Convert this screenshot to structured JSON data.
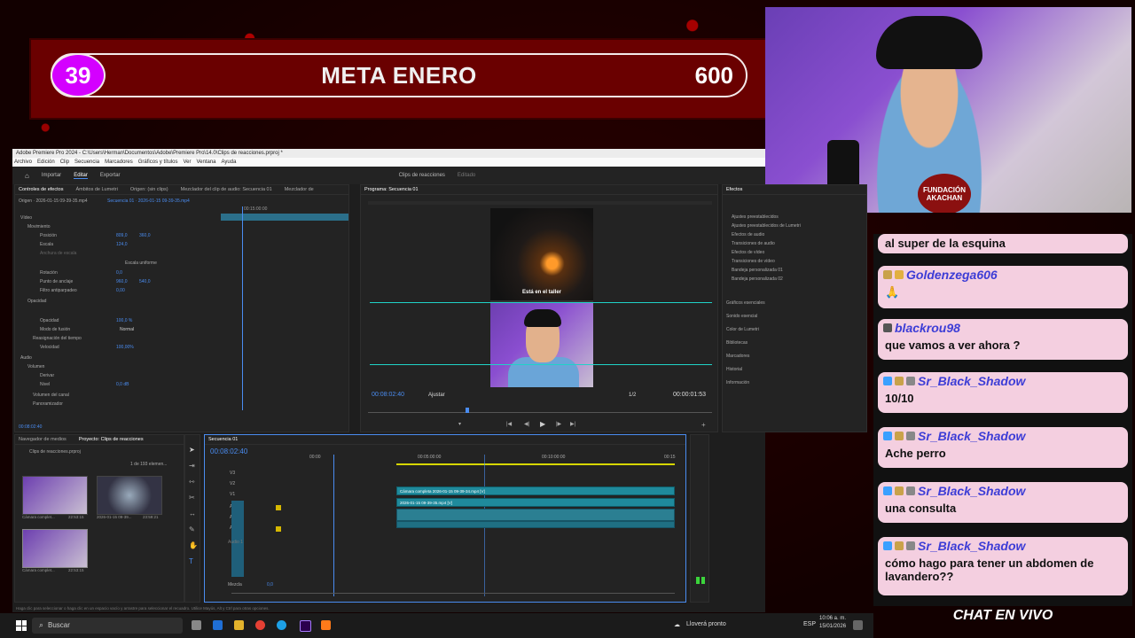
{
  "banner": {
    "count": "39",
    "title": "META ENERO",
    "goal": "600"
  },
  "webcam": {
    "logo_text": "FUNDACIÓN AKACHAN"
  },
  "chat": {
    "partial_top": "al super de la esquina",
    "messages": [
      {
        "user": "Goldenzega606",
        "text": ""
      },
      {
        "user": "blackrou98",
        "text": "que vamos a ver ahora ?"
      },
      {
        "user": "Sr_Black_Shadow",
        "text": "10/10"
      },
      {
        "user": "Sr_Black_Shadow",
        "text": "Ache perro"
      },
      {
        "user": "Sr_Black_Shadow",
        "text": "una consulta"
      },
      {
        "user": "Sr_Black_Shadow",
        "text": "cómo hago para tener un abdomen de lavandero??"
      }
    ],
    "footer": "CHAT EN VIVO"
  },
  "premiere": {
    "window_title": "Adobe Premiere Pro 2024 - C:\\Users\\Herman\\Documentos\\Adobe\\Premiere Pro\\14.0\\Clips de reacciones.prproj *",
    "menu": [
      "Archivo",
      "Edición",
      "Clip",
      "Secuencia",
      "Marcadores",
      "Gráficos y títulos",
      "Ver",
      "Ventana",
      "Ayuda"
    ],
    "workspace_tabs": [
      "Importar",
      "Editar",
      "Exportar"
    ],
    "project_title": "Clips de reacciones",
    "project_status": "Editado",
    "effect_controls": {
      "tabs": [
        "Controles de efectos",
        "Ámbitos de Lumetri",
        "Origen: (sin clips)",
        "Mezclador del clip de audio: Secuencia 01",
        "Mezclador de"
      ],
      "source": "Origen · 2026-01-15 09-39-35.mp4",
      "seq": "Secuencia 01 · 2026-01-15 09-39-35.mp4",
      "timecode": "00:15:00:00",
      "rows": [
        {
          "label": "Vídeo",
          "v1": "",
          "v2": ""
        },
        {
          "label": "Movimiento",
          "v1": "",
          "v2": ""
        },
        {
          "label": "Posición",
          "v1": "809,0",
          "v2": "360,0"
        },
        {
          "label": "Escala",
          "v1": "124,0",
          "v2": ""
        },
        {
          "label": "Anchura de escala",
          "v1": "",
          "v2": ""
        },
        {
          "label": "Escala uniforme",
          "v1": "",
          "v2": ""
        },
        {
          "label": "Rotación",
          "v1": "0,0",
          "v2": ""
        },
        {
          "label": "Punto de anclaje",
          "v1": "960,0",
          "v2": "540,0"
        },
        {
          "label": "Filtro antiparpadeo",
          "v1": "0,00",
          "v2": ""
        },
        {
          "label": "Opacidad",
          "v1": "",
          "v2": ""
        },
        {
          "label": "Opacidad",
          "v1": "100,0 %",
          "v2": ""
        },
        {
          "label": "Modo de fusión",
          "v1": "Normal",
          "v2": ""
        },
        {
          "label": "Reasignación del tiempo",
          "v1": "",
          "v2": ""
        },
        {
          "label": "Velocidad",
          "v1": "100,00%",
          "v2": ""
        },
        {
          "label": "Audio",
          "v1": "",
          "v2": ""
        },
        {
          "label": "Volumen",
          "v1": "",
          "v2": ""
        },
        {
          "label": "Derivar",
          "v1": "",
          "v2": ""
        },
        {
          "label": "Nivel",
          "v1": "0,0 dB",
          "v2": ""
        },
        {
          "label": "Volumen del canal",
          "v1": "",
          "v2": ""
        },
        {
          "label": "Panoramizador",
          "v1": "",
          "v2": ""
        }
      ],
      "bottom_timecode": "00:08:02:40"
    },
    "program": {
      "tab": "Programa: Secuencia 01",
      "caption": "Está en el taller",
      "current_tc": "00:08:02:40",
      "fit": "Ajustar",
      "ratio": "1/2",
      "duration": "00:00:01:53"
    },
    "effects": {
      "tab": "Efectos",
      "folders": [
        "Ajustes preestablecidos",
        "Ajustes preestablecidos de Lumetri",
        "Efectos de audio",
        "Transiciones de audio",
        "Efectos de vídeo",
        "Transiciones de vídeo",
        "Bandeja personalizada 01",
        "Bandeja personalizada 02"
      ],
      "sections": [
        "Gráficos esenciales",
        "Sonido esencial",
        "Color de Lumetri",
        "Bibliotecas",
        "Marcadores",
        "Historial",
        "Información"
      ]
    },
    "project": {
      "tabs": [
        "Navegador de medios",
        "Proyecto: Clips de reacciones"
      ],
      "file": "Clips de reacciones.prproj",
      "count": "1 de 193 elemen...",
      "items": [
        {
          "name": "Cámara complet...",
          "dur": "22:53:15"
        },
        {
          "name": "2026-01-15 09-39...",
          "dur": "23:59:21"
        },
        {
          "name": "Cámara complet...",
          "dur": "22:53:15"
        }
      ]
    },
    "timeline": {
      "tab": "Secuencia 01",
      "current_tc": "00:08:02:40",
      "ruler": [
        "00:00",
        "00:05:00:00",
        "00:10:00:00",
        "00:15"
      ],
      "tracks": [
        "V3",
        "V2",
        "V1",
        "A1",
        "A2",
        "A3"
      ],
      "clip_v2": "Cámara completa 2026-01-15 09-39-34.mp4 [V]",
      "clip_v1": "2026-01-15 09-39-35.mp4 [V]",
      "mix_label": "Mezcla",
      "mix_value": "0,0",
      "audio_label": "Audio 1"
    },
    "status": "Haga clic para seleccionar o haga clic en un espacio vacío y arrastre para seleccionar el recuadro. Utilice Mayús, Alt y Ctrl para otras opciones."
  },
  "taskbar": {
    "search_placeholder": "Buscar",
    "weather": "Lloverá pronto",
    "lang": "ESP",
    "time": "10:06 a. m.",
    "date": "15/01/2026"
  }
}
